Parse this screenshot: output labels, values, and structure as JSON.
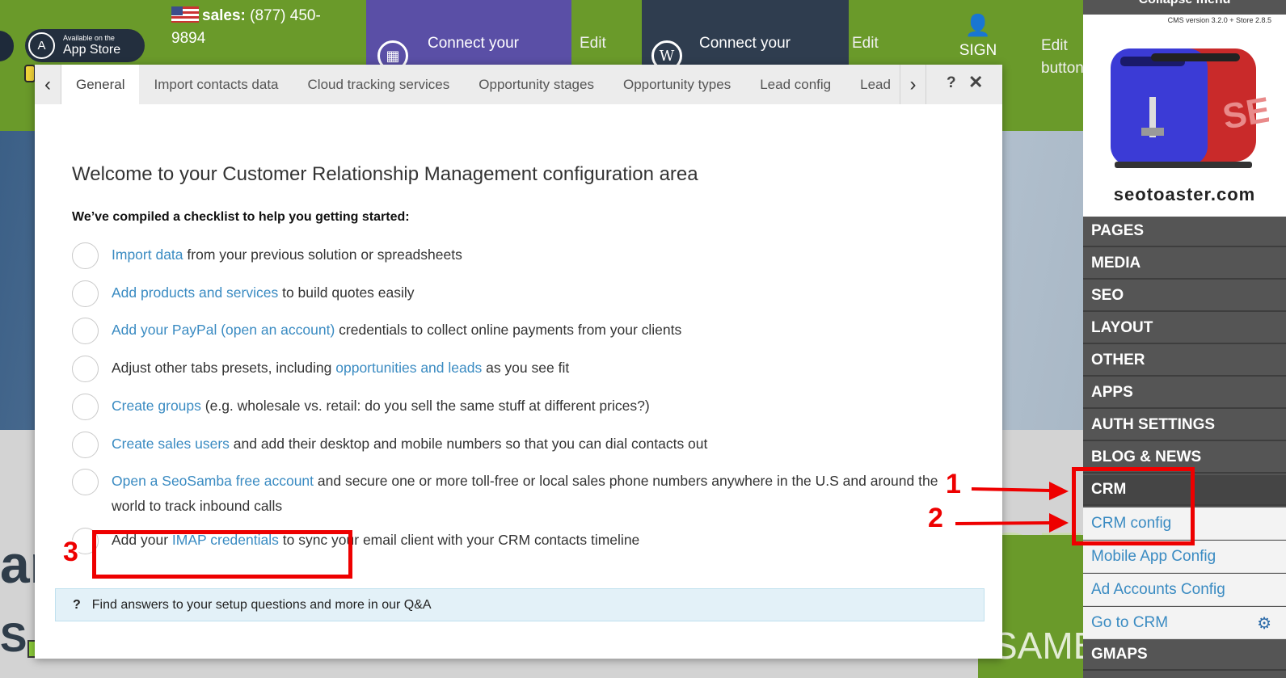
{
  "background": {
    "appstore_small": "Available on the",
    "appstore_big": "App Store",
    "sales_label": "sales:",
    "sales_phone": "(877) 450-9894",
    "connect_1": "Connect your",
    "connect_2": "Connect your",
    "edit_1": "Edit",
    "edit_2": "Edit",
    "edit_3": "Edit",
    "edit_3_line2": "button",
    "sign_label": "SIGN",
    "big_text_1": "an",
    "big_text_2": "S",
    "seo_text": "SEO",
    "samba_text": "SAMBA"
  },
  "modal": {
    "tabs": [
      "General",
      "Import contacts data",
      "Cloud tracking services",
      "Opportunity stages",
      "Opportunity types",
      "Lead config",
      "Lead"
    ],
    "active_tab": "General",
    "help_label": "?",
    "close_label": "✕",
    "title": "Welcome to your Customer Relationship Management configuration area",
    "subtitle": "We’ve compiled a checklist to help you getting started:",
    "checklist": [
      {
        "link": "Import data",
        "text": " from your previous solution or spreadsheets"
      },
      {
        "link": "Add products and services",
        "text": " to build quotes easily"
      },
      {
        "link": "Add your PayPal (open an account)",
        "text": " credentials to collect online payments from your clients"
      },
      {
        "pre": "Adjust other tabs presets, including ",
        "link": "opportunities and leads",
        "text": " as you see fit"
      },
      {
        "link": "Create groups",
        "text": " (e.g. wholesale vs. retail: do you sell the same stuff at different prices?)"
      },
      {
        "link": "Create sales users",
        "text": " and add their desktop and mobile numbers so that you can dial contacts out"
      },
      {
        "link": "Open a SeoSamba free account",
        "text": " and secure one or more toll-free or local sales phone numbers anywhere in the U.S and around the world to track inbound calls"
      },
      {
        "pre": "Add your ",
        "link": "IMAP credentials",
        "text": " to sync your email client with your CRM contacts timeline"
      }
    ],
    "qa_icon": "?",
    "qa_text": "Find answers to your setup questions and more in our Q&A"
  },
  "admin_menu": {
    "collapse": "Collapse menu",
    "version": "CMS version 3.2.0 + Store 2.8.5",
    "logo_text": "seotoaster.com",
    "items": [
      "PAGES",
      "MEDIA",
      "SEO",
      "LAYOUT",
      "OTHER",
      "APPS",
      "AUTH SETTINGS",
      "BLOG & NEWS",
      "CRM"
    ],
    "crm_sub": [
      "CRM config",
      "Mobile App Config",
      "Ad Accounts Config",
      "Go to CRM"
    ],
    "last_item": "GMAPS"
  },
  "annotations": {
    "step_1": "1",
    "step_2": "2",
    "step_3": "3",
    "color": "#e00000"
  },
  "colors": {
    "brand_green": "#6a9a2a",
    "link_blue": "#3a8bc2",
    "menu_gray": "#555555"
  }
}
